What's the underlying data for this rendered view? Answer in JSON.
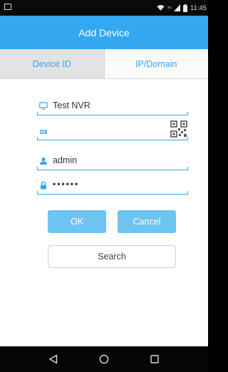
{
  "status_bar": {
    "time": "11:45",
    "icons": [
      "notification-icon",
      "wifi-icon",
      "signal-icon",
      "battery-icon"
    ]
  },
  "header": {
    "title": "Add Device"
  },
  "tabs": [
    {
      "label": "Device ID",
      "active": true
    },
    {
      "label": "IP/Domain",
      "active": false
    }
  ],
  "form": {
    "device_name": {
      "value": "Test NVR",
      "icon": "monitor-icon"
    },
    "device_id": {
      "value": "",
      "icon": "barcode-icon",
      "action_icon": "qr-code-icon"
    },
    "username": {
      "value": "admin",
      "icon": "user-icon"
    },
    "password": {
      "value": "••••••",
      "icon": "lock-icon"
    }
  },
  "buttons": {
    "ok_label": "OK",
    "cancel_label": "Cancel",
    "search_label": "Search"
  },
  "nav": [
    "back-icon",
    "home-icon",
    "recents-icon"
  ],
  "colors": {
    "accent": "#33a8f0",
    "button_fill": "#6ec3f1"
  }
}
